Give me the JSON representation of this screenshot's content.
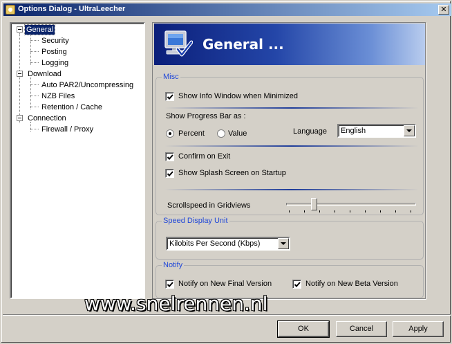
{
  "window": {
    "title": "Options Dialog - UltraLeecher"
  },
  "tree": {
    "items": [
      {
        "label": "General"
      },
      {
        "label": "Security"
      },
      {
        "label": "Posting"
      },
      {
        "label": "Logging"
      },
      {
        "label": "Download"
      },
      {
        "label": "Auto PAR2/Uncompressing"
      },
      {
        "label": "NZB Files"
      },
      {
        "label": "Retention / Cache"
      },
      {
        "label": "Connection"
      },
      {
        "label": "Firewall / Proxy"
      }
    ],
    "selected": "General"
  },
  "banner": {
    "title": "General  ...",
    "icon": "monitor-check-icon"
  },
  "misc": {
    "title": "Misc",
    "show_info_window": {
      "label": "Show Info Window when Minimized",
      "checked": true
    },
    "progress_label": "Show Progress Bar as :",
    "percent": {
      "label": "Percent",
      "selected": true
    },
    "value": {
      "label": "Value",
      "selected": false
    },
    "language_label": "Language",
    "language_value": "English",
    "confirm_exit": {
      "label": "Confirm on Exit",
      "checked": true
    },
    "splash": {
      "label": "Show Splash Screen on Startup",
      "checked": true
    },
    "scroll_label": "Scrollspeed in Gridviews",
    "scroll_position": 0.2
  },
  "speed": {
    "title": "Speed Display Unit",
    "value": "Kilobits Per Second (Kbps)"
  },
  "notify": {
    "title": "Notify",
    "final": {
      "label": "Notify on New Final Version",
      "checked": true
    },
    "beta": {
      "label": "Notify on New Beta Version",
      "checked": true
    }
  },
  "watermark": "www.snelrennen.nl",
  "buttons": {
    "ok": "OK",
    "cancel": "Cancel",
    "apply": "Apply"
  }
}
